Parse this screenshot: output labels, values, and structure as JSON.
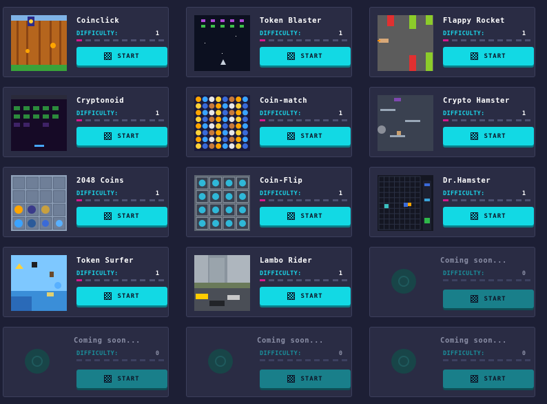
{
  "games": [
    {
      "title": "Coinclick",
      "difficulty_label": "DIFFICULTY:",
      "difficulty": "1",
      "button": "START",
      "soon": false,
      "thumb": "coinclick-thumbnail"
    },
    {
      "title": "Token Blaster",
      "difficulty_label": "DIFFICULTY:",
      "difficulty": "1",
      "button": "START",
      "soon": false,
      "thumb": "token-blaster-thumbnail"
    },
    {
      "title": "Flappy Rocket",
      "difficulty_label": "DIFFICULTY:",
      "difficulty": "1",
      "button": "START",
      "soon": false,
      "thumb": "flappy-rocket-thumbnail"
    },
    {
      "title": "Cryptonoid",
      "difficulty_label": "DIFFICULTY:",
      "difficulty": "1",
      "button": "START",
      "soon": false,
      "thumb": "cryptonoid-thumbnail"
    },
    {
      "title": "Coin-match",
      "difficulty_label": "DIFFICULTY:",
      "difficulty": "1",
      "button": "START",
      "soon": false,
      "thumb": "coin-match-thumbnail"
    },
    {
      "title": "Crypto Hamster",
      "difficulty_label": "DIFFICULTY:",
      "difficulty": "1",
      "button": "START",
      "soon": false,
      "thumb": "crypto-hamster-thumbnail"
    },
    {
      "title": "2048 Coins",
      "difficulty_label": "DIFFICULTY:",
      "difficulty": "1",
      "button": "START",
      "soon": false,
      "thumb": "2048-coins-thumbnail"
    },
    {
      "title": "Coin-Flip",
      "difficulty_label": "DIFFICULTY:",
      "difficulty": "1",
      "button": "START",
      "soon": false,
      "thumb": "coin-flip-thumbnail"
    },
    {
      "title": "Dr.Hamster",
      "difficulty_label": "DIFFICULTY:",
      "difficulty": "1",
      "button": "START",
      "soon": false,
      "thumb": "dr-hamster-thumbnail"
    },
    {
      "title": "Token Surfer",
      "difficulty_label": "DIFFICULTY:",
      "difficulty": "1",
      "button": "START",
      "soon": false,
      "thumb": "token-surfer-thumbnail"
    },
    {
      "title": "Lambo Rider",
      "difficulty_label": "DIFFICULTY:",
      "difficulty": "1",
      "button": "START",
      "soon": false,
      "thumb": "lambo-rider-thumbnail"
    },
    {
      "title": "Coming soon...",
      "difficulty_label": "DIFFICULTY:",
      "difficulty": "0",
      "button": "START",
      "soon": true,
      "thumb": "placeholder-icon"
    },
    {
      "title": "Coming soon...",
      "difficulty_label": "DIFFICULTY:",
      "difficulty": "0",
      "button": "START",
      "soon": true,
      "thumb": "placeholder-icon"
    },
    {
      "title": "Coming soon...",
      "difficulty_label": "DIFFICULTY:",
      "difficulty": "0",
      "button": "START",
      "soon": true,
      "thumb": "placeholder-icon"
    },
    {
      "title": "Coming soon...",
      "difficulty_label": "DIFFICULTY:",
      "difficulty": "0",
      "button": "START",
      "soon": true,
      "thumb": "placeholder-icon"
    }
  ],
  "colors": {
    "background": "#1d1f35",
    "card": "#2a2c44",
    "accent": "#12d9e4",
    "difficulty_on": "#d6198e",
    "difficulty_off": "#4d5171",
    "label": "#1bd3e6"
  }
}
